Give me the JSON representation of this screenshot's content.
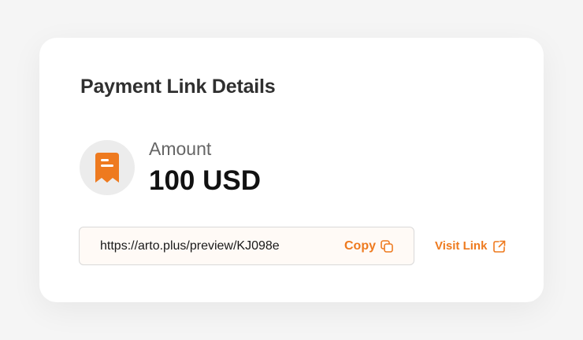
{
  "card": {
    "title": "Payment Link Details"
  },
  "amount": {
    "label": "Amount",
    "value": "100 USD",
    "icon": "receipt-icon"
  },
  "link": {
    "url": "https://arto.plus/preview/KJ098e",
    "copy_label": "Copy",
    "copy_icon": "copy-icon",
    "visit_label": "Visit Link",
    "visit_icon": "external-link-icon"
  },
  "colors": {
    "accent": "#ee7a1f",
    "background": "#f5f5f5",
    "card": "#ffffff",
    "icon_bg": "#ececec"
  }
}
